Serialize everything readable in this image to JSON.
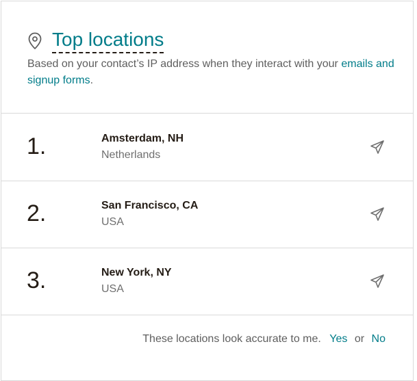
{
  "header": {
    "icon": "map-pin-icon",
    "title": "Top locations",
    "description_text": "Based on your contact’s IP address when they interact with your",
    "description_link": "emails and signup forms",
    "description_end": "."
  },
  "locations": [
    {
      "rank": "1.",
      "city": "Amsterdam, NH",
      "country": "Netherlands",
      "action_icon": "send-icon"
    },
    {
      "rank": "2.",
      "city": "San Francisco, CA",
      "country": "USA",
      "action_icon": "send-icon"
    },
    {
      "rank": "3.",
      "city": "New York, NY",
      "country": "USA",
      "action_icon": "send-icon"
    }
  ],
  "footer": {
    "prompt": "These locations look accurate to me.",
    "yes_label": "Yes",
    "or_label": "or",
    "no_label": "No"
  },
  "colors": {
    "accent": "#007c89",
    "text": "#241c15",
    "muted": "#6f6f6f",
    "border": "#d9d9d9"
  }
}
